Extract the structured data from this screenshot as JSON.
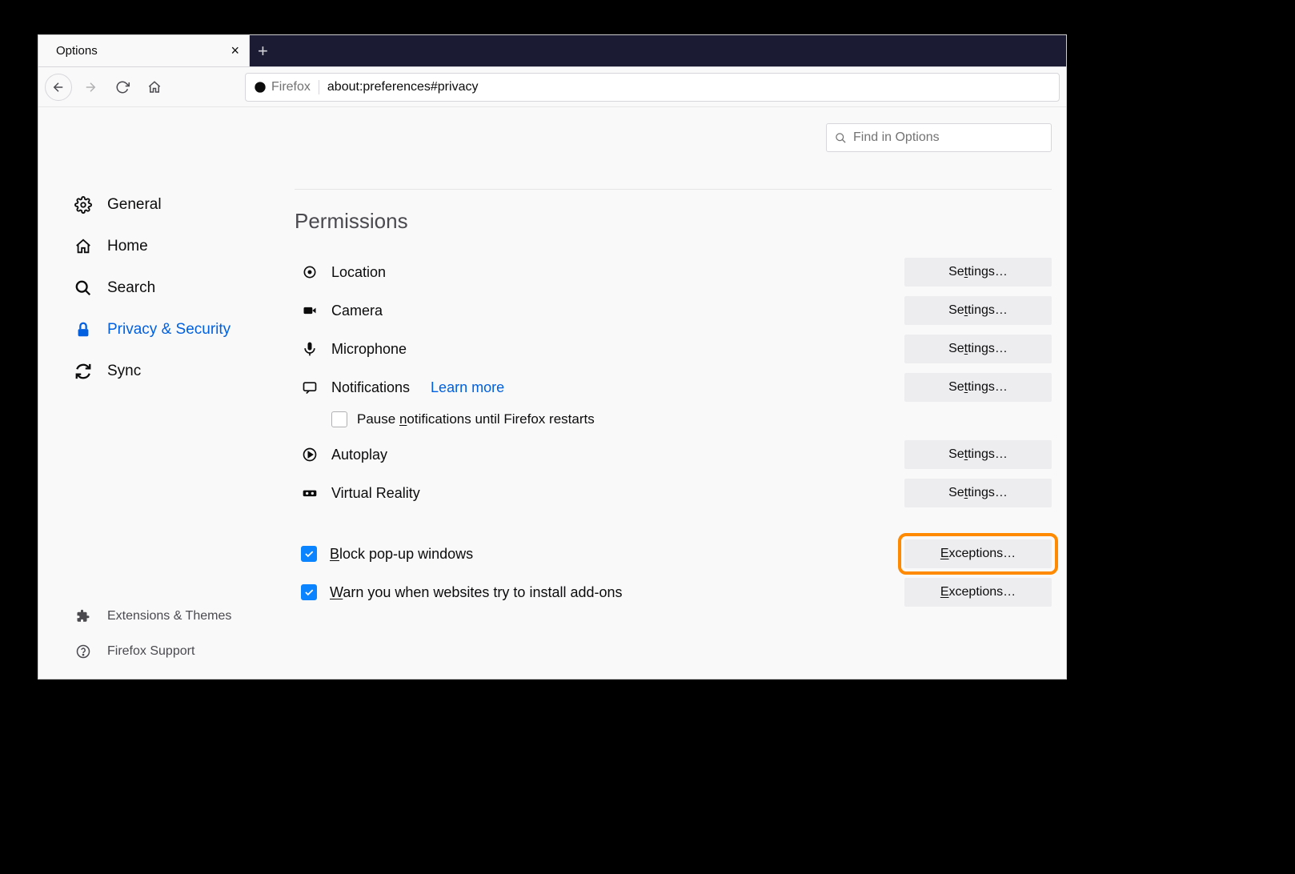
{
  "tab": {
    "title": "Options"
  },
  "url": {
    "identity": "Firefox",
    "path": "about:preferences#privacy"
  },
  "search": {
    "placeholder": "Find in Options"
  },
  "sidebar": {
    "items": [
      {
        "label": "General"
      },
      {
        "label": "Home"
      },
      {
        "label": "Search"
      },
      {
        "label": "Privacy & Security"
      },
      {
        "label": "Sync"
      }
    ],
    "footer": [
      {
        "label": "Extensions & Themes"
      },
      {
        "label": "Firefox Support"
      }
    ]
  },
  "section": {
    "title": "Permissions"
  },
  "perms": {
    "location": {
      "label": "Location",
      "btn_pre": "Se",
      "btn_u": "t",
      "btn_post": "tings…"
    },
    "camera": {
      "label": "Camera",
      "btn_pre": "Se",
      "btn_u": "t",
      "btn_post": "tings…"
    },
    "microphone": {
      "label": "Microphone",
      "btn_pre": "Se",
      "btn_u": "t",
      "btn_post": "tings…"
    },
    "notifications": {
      "label": "Notifications",
      "learn_more": "Learn more",
      "btn_pre": "Se",
      "btn_u": "t",
      "btn_post": "tings…"
    },
    "notifications_pause": {
      "pre": "Pause ",
      "u": "n",
      "post": "otifications until Firefox restarts"
    },
    "autoplay": {
      "label": "Autoplay",
      "btn_pre": "Se",
      "btn_u": "t",
      "btn_post": "tings…"
    },
    "vr": {
      "label": "Virtual Reality",
      "btn_pre": "Se",
      "btn_u": "t",
      "btn_post": "tings…"
    },
    "popups": {
      "u": "B",
      "post": "lock pop-up windows",
      "btn_u": "E",
      "btn_post": "xceptions…"
    },
    "addons": {
      "u": "W",
      "post": "arn you when websites try to install add-ons",
      "btn_u": "E",
      "btn_post": "xceptions…"
    }
  }
}
